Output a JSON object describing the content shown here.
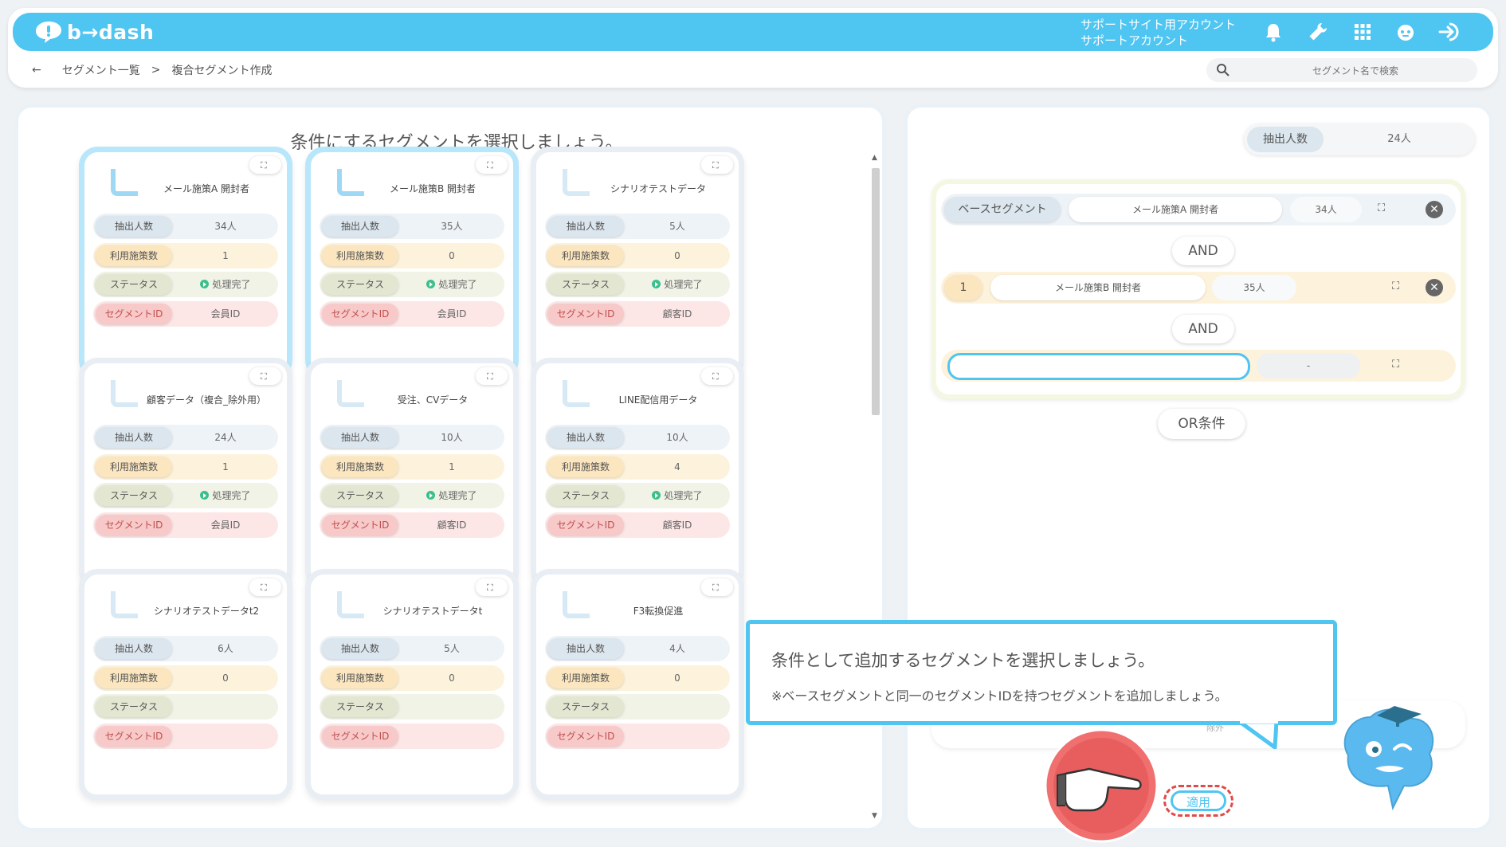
{
  "app": {
    "logo_text": "b→dash",
    "account_line1": "サポートサイト用アカウント",
    "account_line2": "サポートアカウント"
  },
  "breadcrumb": {
    "back": "←",
    "parent": "セグメント一覧",
    "sep": ">",
    "current": "複合セグメント作成"
  },
  "search": {
    "placeholder": "セグメント名で検索"
  },
  "left": {
    "title": "条件にするセグメントを選択しましょう。"
  },
  "row_labels": {
    "count": "抽出人数",
    "used": "利用施策数",
    "status": "ステータス",
    "segid": "セグメントID"
  },
  "cards": [
    {
      "title": "メール施策A 開封者",
      "count": "34人",
      "used": "1",
      "status": "処理完了",
      "segid": "会員ID",
      "selected": true
    },
    {
      "title": "メール施策B 開封者",
      "count": "35人",
      "used": "0",
      "status": "処理完了",
      "segid": "会員ID",
      "selected": true
    },
    {
      "title": "シナリオテストデータ",
      "count": "5人",
      "used": "0",
      "status": "処理完了",
      "segid": "顧客ID",
      "selected": false
    },
    {
      "title": "顧客データ（複合_除外用）",
      "count": "24人",
      "used": "1",
      "status": "処理完了",
      "segid": "会員ID",
      "selected": false
    },
    {
      "title": "受注、CVデータ",
      "count": "10人",
      "used": "1",
      "status": "処理完了",
      "segid": "顧客ID",
      "selected": false
    },
    {
      "title": "LINE配信用データ",
      "count": "10人",
      "used": "4",
      "status": "処理完了",
      "segid": "顧客ID",
      "selected": false
    },
    {
      "title": "シナリオテストデータt2",
      "count": "6人",
      "used": "0",
      "status": "",
      "segid": "",
      "selected": false
    },
    {
      "title": "シナリオテストデータt",
      "count": "5人",
      "used": "0",
      "status": "",
      "segid": "",
      "selected": false
    },
    {
      "title": "F3転換促進",
      "count": "4人",
      "used": "0",
      "status": "",
      "segid": "",
      "selected": false
    }
  ],
  "right": {
    "count_label": "抽出人数",
    "count_value": "24人",
    "base": {
      "tag": "ベースセグメント",
      "name": "メール施策A 開封者",
      "count": "34人"
    },
    "and1": "AND",
    "cond1": {
      "tag": "1",
      "name": "メール施策B 開封者",
      "count": "35人"
    },
    "and2": "AND",
    "cond2": {
      "count": "-"
    },
    "or_label": "OR条件",
    "hidden_text": "除外"
  },
  "tooltip": {
    "line1": "条件として追加するセグメントを選択しましょう。",
    "line2": "※ベースセグメントと同一のセグメントIDを持つセグメントを追加しましょう。"
  },
  "apply": "適用",
  "colors": {
    "accent": "#4fc5f2",
    "status_ok": "#3cbf8c",
    "highlight": "#e04a4a"
  }
}
